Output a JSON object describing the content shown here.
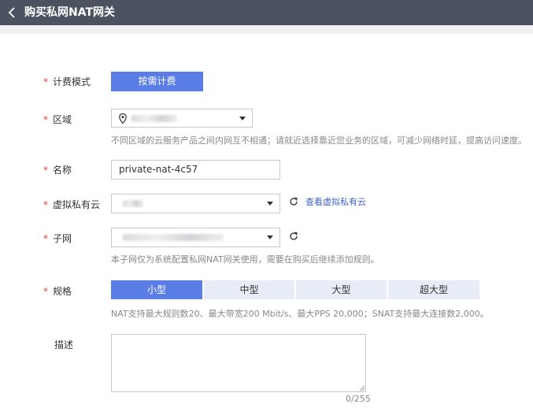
{
  "header": {
    "title": "购买私网NAT网关"
  },
  "form": {
    "required_mark": "*",
    "billing": {
      "label": "计费模式",
      "button": "按需计费"
    },
    "region": {
      "label": "区域",
      "hint": "不同区域的云服务产品之间内网互不相通；请就近选择靠近您业务的区域，可减少网络时延，提高访问速度。"
    },
    "name": {
      "label": "名称",
      "value": "private-nat-4c57"
    },
    "vpc": {
      "label": "虚拟私有云",
      "link": "查看虚拟私有云"
    },
    "subnet": {
      "label": "子网",
      "hint": "本子网仅为系统配置私网NAT网关使用，需要在购买后继续添加规则。"
    },
    "spec": {
      "label": "规格",
      "options": [
        "小型",
        "中型",
        "大型",
        "超大型"
      ],
      "selected": "小型",
      "hint": "NAT支持最大规则数20、最大带宽200 Mbit/s、最大PPS 20,000；SNAT支持最大连接数2,000。"
    },
    "description": {
      "label": "描述",
      "counter": "0/255"
    }
  },
  "colors": {
    "primary": "#5a7de5",
    "header_bg": "#4d5260",
    "required": "#e0443e",
    "link": "#3e63c8"
  }
}
